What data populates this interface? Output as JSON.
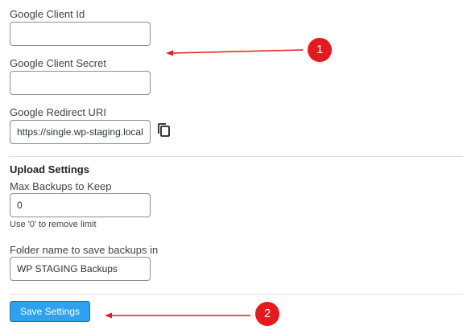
{
  "google": {
    "client_id_label": "Google Client Id",
    "client_id_value": "",
    "client_secret_label": "Google Client Secret",
    "client_secret_value": "",
    "redirect_uri_label": "Google Redirect URI",
    "redirect_uri_value": "https://single.wp-staging.local"
  },
  "upload": {
    "section_title": "Upload Settings",
    "max_backups_label": "Max Backups to Keep",
    "max_backups_value": "0",
    "max_backups_hint": "Use '0' to remove limit",
    "folder_label": "Folder name to save backups in",
    "folder_value": "WP STAGING Backups"
  },
  "actions": {
    "save_label": "Save Settings"
  },
  "annotations": {
    "badge_1": "1",
    "badge_2": "2",
    "color": "#e7191f"
  },
  "icons": {
    "copy": "copy-icon"
  }
}
